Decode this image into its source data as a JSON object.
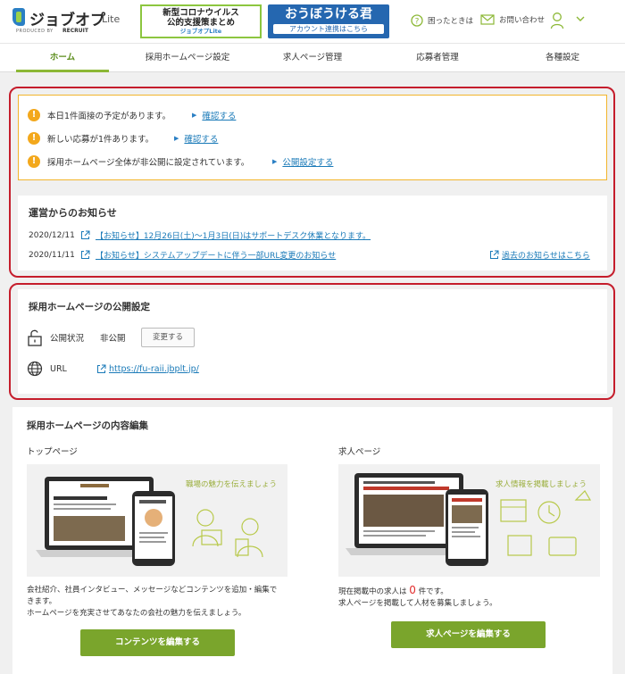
{
  "header": {
    "logo": {
      "main": "ジョブオプ",
      "lite": "Lite",
      "produced": "PRODUCED BY",
      "recruit": "RECRUIT"
    },
    "covid_banner": {
      "line1": "新型コロナウイルス",
      "line2": "公的支援策まとめ",
      "line3": "ジョブオプLite"
    },
    "ouboo_banner": {
      "title": "おうぼうける君",
      "sub": "アカウント連携はこちら"
    },
    "help": "困ったときは",
    "contact": "お問い合わせ"
  },
  "nav": {
    "tabs": [
      "ホーム",
      "採用ホームページ設定",
      "求人ページ管理",
      "応募者管理",
      "各種設定"
    ],
    "active": 0
  },
  "alerts": [
    {
      "text": "本日1件面接の予定があります。",
      "link": "確認する"
    },
    {
      "text": "新しい応募が1件あります。",
      "link": "確認する"
    },
    {
      "text": "採用ホームページ全体が非公開に設定されています。",
      "link": "公開設定する"
    }
  ],
  "news": {
    "title": "運営からのお知らせ",
    "items": [
      {
        "date": "2020/12/11",
        "text": "【お知らせ】12月26日(土)～1月3日(日)はサポートデスク休業となります。"
      },
      {
        "date": "2020/11/11",
        "text": "【お知らせ】システムアップデートに伴う一部URL変更のお知らせ"
      }
    ],
    "past_link": "過去のお知らせはこちら"
  },
  "publish": {
    "title": "採用ホームページの公開設定",
    "status_label": "公開状況",
    "status_value": "非公開",
    "change_button": "変更する",
    "url_label": "URL",
    "url": "https://fu-raii.jbplt.jp/"
  },
  "edit": {
    "title": "採用ホームページの内容編集",
    "top": {
      "title": "トップページ",
      "illus_caption": "職場の魅力を伝えましょう",
      "desc1": "会社紹介、社員インタビュー、メッセージなどコンテンツを追加・編集で",
      "desc2": "きます。",
      "desc3": "ホームページを充実させてあなたの会社の魅力を伝えましょう。",
      "button": "コンテンツを編集する"
    },
    "job": {
      "title": "求人ページ",
      "illus_caption": "求人情報を掲載しましょう",
      "desc_pre": "現在掲載中の求人は",
      "count": "0",
      "desc_post": "件です。",
      "desc2": "求人ページを掲載して人材を募集しましょう。",
      "button": "求人ページを編集する"
    }
  },
  "colors": {
    "accent_green": "#7aa52c",
    "alert_orange": "#f3a81c",
    "frame_red": "#c51d2c",
    "link_blue": "#1a7ab8"
  }
}
